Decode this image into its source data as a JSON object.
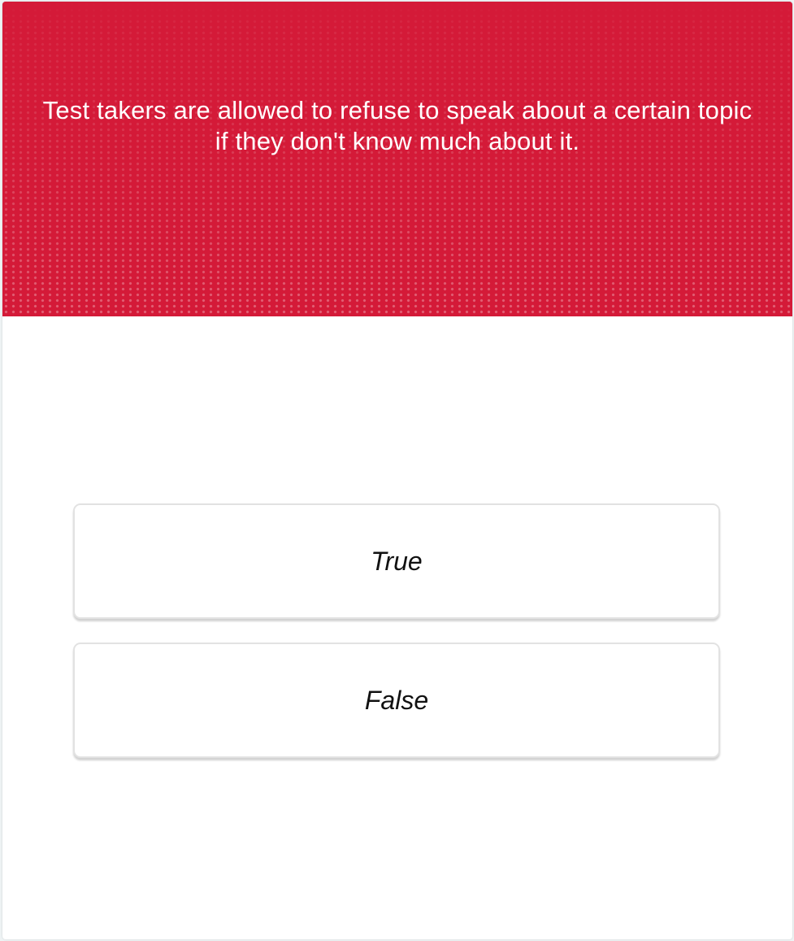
{
  "quiz": {
    "question": "Test takers are allowed to refuse to speak about a certain topic if they don't know much about it.",
    "answers": [
      "True",
      "False"
    ]
  },
  "colors": {
    "header_background": "#d41a38",
    "question_text": "#ffffff",
    "answer_text": "#111111",
    "card_background": "#ffffff"
  }
}
